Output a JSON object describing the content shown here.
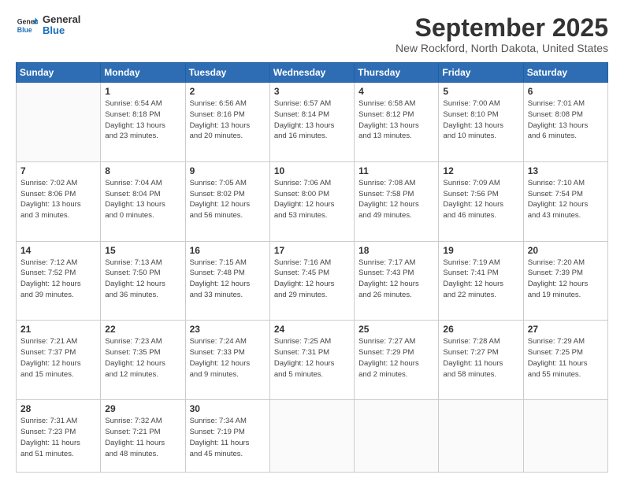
{
  "header": {
    "logo_general": "General",
    "logo_blue": "Blue",
    "month_title": "September 2025",
    "location": "New Rockford, North Dakota, United States"
  },
  "weekdays": [
    "Sunday",
    "Monday",
    "Tuesday",
    "Wednesday",
    "Thursday",
    "Friday",
    "Saturday"
  ],
  "weeks": [
    [
      {
        "day": "",
        "info": ""
      },
      {
        "day": "1",
        "info": "Sunrise: 6:54 AM\nSunset: 8:18 PM\nDaylight: 13 hours\nand 23 minutes."
      },
      {
        "day": "2",
        "info": "Sunrise: 6:56 AM\nSunset: 8:16 PM\nDaylight: 13 hours\nand 20 minutes."
      },
      {
        "day": "3",
        "info": "Sunrise: 6:57 AM\nSunset: 8:14 PM\nDaylight: 13 hours\nand 16 minutes."
      },
      {
        "day": "4",
        "info": "Sunrise: 6:58 AM\nSunset: 8:12 PM\nDaylight: 13 hours\nand 13 minutes."
      },
      {
        "day": "5",
        "info": "Sunrise: 7:00 AM\nSunset: 8:10 PM\nDaylight: 13 hours\nand 10 minutes."
      },
      {
        "day": "6",
        "info": "Sunrise: 7:01 AM\nSunset: 8:08 PM\nDaylight: 13 hours\nand 6 minutes."
      }
    ],
    [
      {
        "day": "7",
        "info": "Sunrise: 7:02 AM\nSunset: 8:06 PM\nDaylight: 13 hours\nand 3 minutes."
      },
      {
        "day": "8",
        "info": "Sunrise: 7:04 AM\nSunset: 8:04 PM\nDaylight: 13 hours\nand 0 minutes."
      },
      {
        "day": "9",
        "info": "Sunrise: 7:05 AM\nSunset: 8:02 PM\nDaylight: 12 hours\nand 56 minutes."
      },
      {
        "day": "10",
        "info": "Sunrise: 7:06 AM\nSunset: 8:00 PM\nDaylight: 12 hours\nand 53 minutes."
      },
      {
        "day": "11",
        "info": "Sunrise: 7:08 AM\nSunset: 7:58 PM\nDaylight: 12 hours\nand 49 minutes."
      },
      {
        "day": "12",
        "info": "Sunrise: 7:09 AM\nSunset: 7:56 PM\nDaylight: 12 hours\nand 46 minutes."
      },
      {
        "day": "13",
        "info": "Sunrise: 7:10 AM\nSunset: 7:54 PM\nDaylight: 12 hours\nand 43 minutes."
      }
    ],
    [
      {
        "day": "14",
        "info": "Sunrise: 7:12 AM\nSunset: 7:52 PM\nDaylight: 12 hours\nand 39 minutes."
      },
      {
        "day": "15",
        "info": "Sunrise: 7:13 AM\nSunset: 7:50 PM\nDaylight: 12 hours\nand 36 minutes."
      },
      {
        "day": "16",
        "info": "Sunrise: 7:15 AM\nSunset: 7:48 PM\nDaylight: 12 hours\nand 33 minutes."
      },
      {
        "day": "17",
        "info": "Sunrise: 7:16 AM\nSunset: 7:45 PM\nDaylight: 12 hours\nand 29 minutes."
      },
      {
        "day": "18",
        "info": "Sunrise: 7:17 AM\nSunset: 7:43 PM\nDaylight: 12 hours\nand 26 minutes."
      },
      {
        "day": "19",
        "info": "Sunrise: 7:19 AM\nSunset: 7:41 PM\nDaylight: 12 hours\nand 22 minutes."
      },
      {
        "day": "20",
        "info": "Sunrise: 7:20 AM\nSunset: 7:39 PM\nDaylight: 12 hours\nand 19 minutes."
      }
    ],
    [
      {
        "day": "21",
        "info": "Sunrise: 7:21 AM\nSunset: 7:37 PM\nDaylight: 12 hours\nand 15 minutes."
      },
      {
        "day": "22",
        "info": "Sunrise: 7:23 AM\nSunset: 7:35 PM\nDaylight: 12 hours\nand 12 minutes."
      },
      {
        "day": "23",
        "info": "Sunrise: 7:24 AM\nSunset: 7:33 PM\nDaylight: 12 hours\nand 9 minutes."
      },
      {
        "day": "24",
        "info": "Sunrise: 7:25 AM\nSunset: 7:31 PM\nDaylight: 12 hours\nand 5 minutes."
      },
      {
        "day": "25",
        "info": "Sunrise: 7:27 AM\nSunset: 7:29 PM\nDaylight: 12 hours\nand 2 minutes."
      },
      {
        "day": "26",
        "info": "Sunrise: 7:28 AM\nSunset: 7:27 PM\nDaylight: 11 hours\nand 58 minutes."
      },
      {
        "day": "27",
        "info": "Sunrise: 7:29 AM\nSunset: 7:25 PM\nDaylight: 11 hours\nand 55 minutes."
      }
    ],
    [
      {
        "day": "28",
        "info": "Sunrise: 7:31 AM\nSunset: 7:23 PM\nDaylight: 11 hours\nand 51 minutes."
      },
      {
        "day": "29",
        "info": "Sunrise: 7:32 AM\nSunset: 7:21 PM\nDaylight: 11 hours\nand 48 minutes."
      },
      {
        "day": "30",
        "info": "Sunrise: 7:34 AM\nSunset: 7:19 PM\nDaylight: 11 hours\nand 45 minutes."
      },
      {
        "day": "",
        "info": ""
      },
      {
        "day": "",
        "info": ""
      },
      {
        "day": "",
        "info": ""
      },
      {
        "day": "",
        "info": ""
      }
    ]
  ]
}
